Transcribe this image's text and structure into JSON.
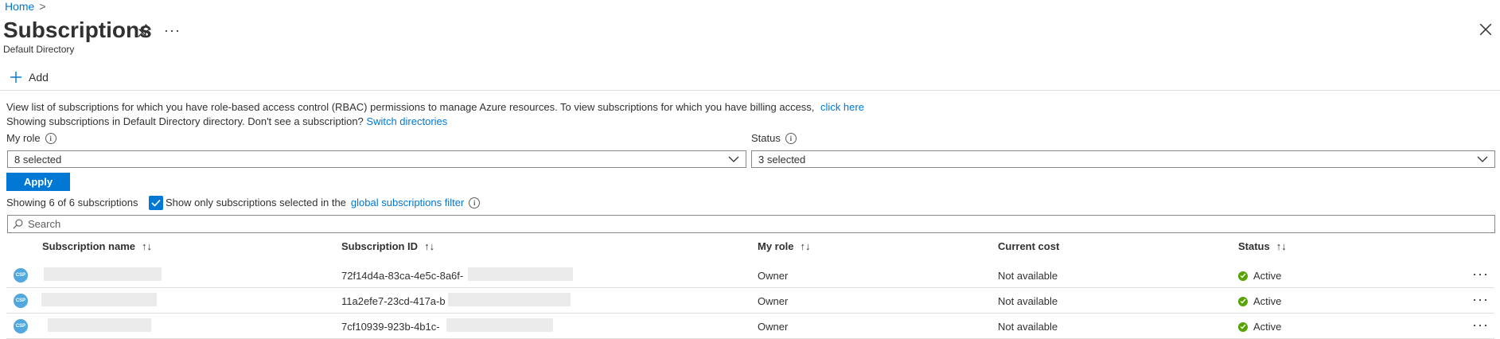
{
  "breadcrumb": {
    "home": "Home",
    "separator": ">"
  },
  "header": {
    "title": "Subscriptions",
    "subtitle": "Default Directory",
    "pin_icon": "pin-icon",
    "more_label": "···",
    "close_icon": "close-icon"
  },
  "toolbar": {
    "add_label": "Add"
  },
  "info": {
    "line1_text": "View list of subscriptions for which you have role-based access control (RBAC) permissions to manage Azure resources. To view subscriptions for which you have billing access,",
    "line1_link": "click here",
    "line2_text": "Showing subscriptions in Default Directory directory. Don't see a subscription?",
    "line2_link": "Switch directories"
  },
  "filters": {
    "my_role_label": "My role",
    "my_role_value": "8 selected",
    "status_label": "Status",
    "status_value": "3 selected",
    "apply_label": "Apply"
  },
  "summary": {
    "count_text": "Showing 6 of 6 subscriptions",
    "checkbox_checked": true,
    "checkbox_text": "Show only subscriptions selected in the",
    "checkbox_link": "global subscriptions filter"
  },
  "search": {
    "placeholder": "Search"
  },
  "table": {
    "columns": [
      {
        "label": "Subscription name",
        "sortable": true
      },
      {
        "label": "Subscription ID",
        "sortable": true
      },
      {
        "label": "My role",
        "sortable": true
      },
      {
        "label": "Current cost",
        "sortable": false
      },
      {
        "label": "Status",
        "sortable": true
      }
    ],
    "sort_glyph": "↑↓",
    "icon_text": "CSP",
    "rows": [
      {
        "id_prefix": "72f14d4a-83ca-4e5c-8a6f-",
        "role": "Owner",
        "cost": "Not available",
        "status": "Active",
        "more": "···"
      },
      {
        "id_prefix": "11a2efe7-23cd-417a-b",
        "role": "Owner",
        "cost": "Not available",
        "status": "Active",
        "more": "···"
      },
      {
        "id_prefix": "7cf10939-923b-4b1c-",
        "role": "Owner",
        "cost": "Not available",
        "status": "Active",
        "more": "···"
      }
    ]
  },
  "colors": {
    "accent": "#0078d4",
    "status_ok": "#57a300",
    "csp_badge": "#50a8df"
  }
}
